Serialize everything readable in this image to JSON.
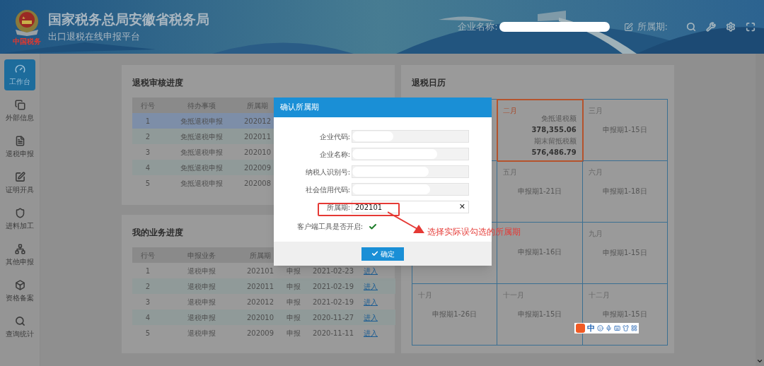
{
  "header": {
    "title": "国家税务总局安徽省税务局",
    "subtitle": "出口退税在线申报平台",
    "logo_text": "中国税务",
    "company_label": "企业名称:",
    "period_label": "所属期:"
  },
  "sidebar": {
    "items": [
      {
        "label": "工作台",
        "selected": true
      },
      {
        "label": "外部信息",
        "selected": false
      },
      {
        "label": "退税申报",
        "selected": false
      },
      {
        "label": "证明开具",
        "selected": false
      },
      {
        "label": "进料加工",
        "selected": false
      },
      {
        "label": "其他申报",
        "selected": false
      },
      {
        "label": "资格备案",
        "selected": false
      },
      {
        "label": "查询统计",
        "selected": false
      }
    ]
  },
  "review_panel": {
    "title": "退税审核进度",
    "columns": [
      "行号",
      "待办事项",
      "所属期"
    ],
    "rows": [
      {
        "cells": [
          "1",
          "免抵退税申报",
          "202012"
        ],
        "selected": true
      },
      {
        "cells": [
          "2",
          "免抵退税申报",
          "202011"
        ],
        "selected": false
      },
      {
        "cells": [
          "3",
          "免抵退税申报",
          "202010"
        ],
        "selected": false
      },
      {
        "cells": [
          "4",
          "免抵退税申报",
          "202009"
        ],
        "selected": false
      },
      {
        "cells": [
          "5",
          "免抵退税申报",
          "202008"
        ],
        "selected": false
      }
    ]
  },
  "business_panel": {
    "title": "我的业务进度",
    "columns": [
      "行号",
      "申报业务",
      "所属期"
    ],
    "rows": [
      {
        "cells": [
          "1",
          "退税申报",
          "202101",
          "申报",
          "2021-02-23"
        ],
        "link": "进入"
      },
      {
        "cells": [
          "2",
          "退税申报",
          "202011",
          "申报",
          "2021-02-19"
        ],
        "link": "进入"
      },
      {
        "cells": [
          "3",
          "退税申报",
          "202012",
          "申报",
          "2021-02-19"
        ],
        "link": "进入"
      },
      {
        "cells": [
          "4",
          "退税申报",
          "202010",
          "申报",
          "2020-11-27"
        ],
        "link": "进入"
      },
      {
        "cells": [
          "5",
          "退税申报",
          "202009",
          "申报",
          "2020-11-11"
        ],
        "link": "进入"
      }
    ]
  },
  "calendar": {
    "title": "退税日历",
    "cells": [
      {
        "kind": "blank",
        "highlighted": false
      },
      {
        "kind": "amounts",
        "month": "二月",
        "highlighted": true,
        "lines": [
          "免抵退税额",
          "378,355.06",
          "期末留抵税额",
          "576,486.79"
        ]
      },
      {
        "kind": "period",
        "month": "三月",
        "text": "申报期1-15日",
        "highlighted": false
      },
      {
        "kind": "blank",
        "highlighted": false
      },
      {
        "kind": "period",
        "month": "五月",
        "text": "申报期1-21日",
        "highlighted": false
      },
      {
        "kind": "period",
        "month": "六月",
        "text": "申报期1-18日",
        "highlighted": false
      },
      {
        "kind": "blank",
        "highlighted": false
      },
      {
        "kind": "period",
        "text": "申报期1-16日",
        "highlighted": false
      },
      {
        "kind": "period",
        "month": "九月",
        "text": "申报期1-15日",
        "highlighted": false
      },
      {
        "kind": "period",
        "month": "十月",
        "text": "申报期1-26日",
        "highlighted": false
      },
      {
        "kind": "period",
        "month": "十一月",
        "text": "申报期1-15日",
        "highlighted": false
      },
      {
        "kind": "period",
        "month": "十二月",
        "text": "申报期1-15日",
        "highlighted": false
      }
    ]
  },
  "dialog": {
    "title": "确认所属期",
    "fields": [
      {
        "label": "企业代码:",
        "kind": "redacted"
      },
      {
        "label": "企业名称:",
        "kind": "redacted"
      },
      {
        "label": "纳税人识别号:",
        "kind": "redacted"
      },
      {
        "label": "社会信用代码:",
        "kind": "redacted"
      },
      {
        "label": "所属期:",
        "kind": "value",
        "value": "202101",
        "clear": "✕"
      }
    ],
    "client_tool": {
      "label": "客户端工具是否开启:",
      "on": true
    },
    "confirm": "确定"
  },
  "annotation": {
    "text": "选择实际误勾选的所属期"
  },
  "ime_toolbar": {
    "mode": "中"
  }
}
